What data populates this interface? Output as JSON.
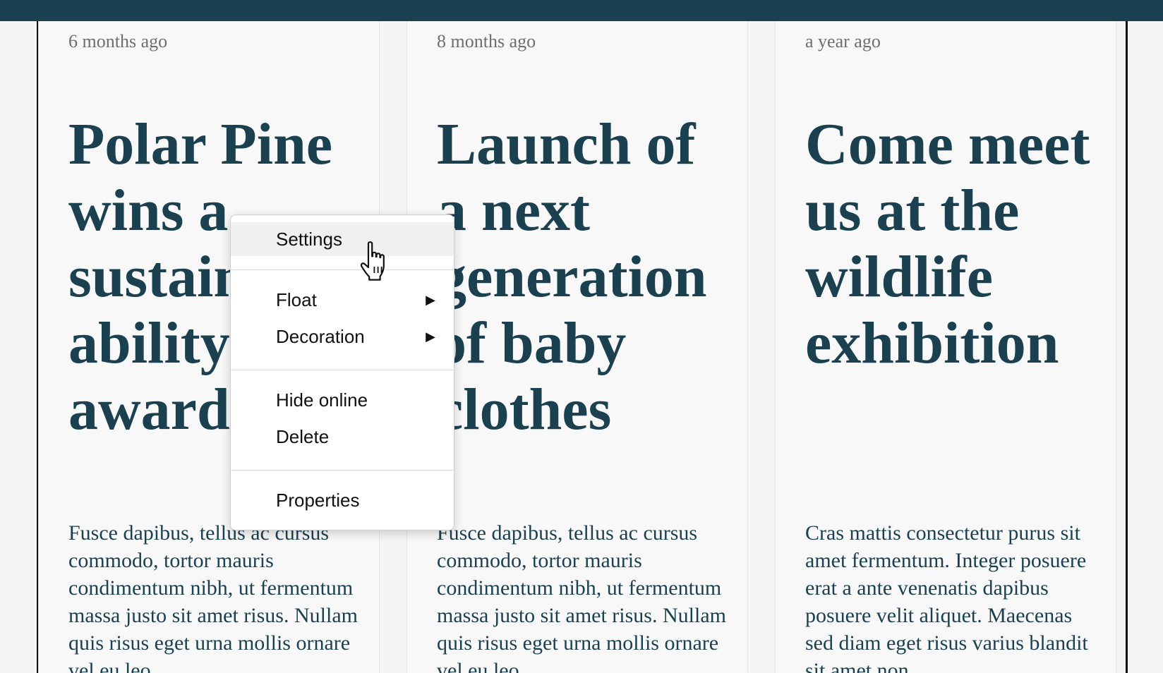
{
  "cards": [
    {
      "date": "6 months ago",
      "title": "Polar Pine wins a sustain-ability award",
      "body": "Fusce dapibus, tellus ac cursus commodo, tortor mauris condimentum nibh, ut fermentum massa justo sit amet risus. Nullam quis risus eget urna mollis ornare vel eu leo."
    },
    {
      "date": "8 months ago",
      "title": "Launch of a next generation of baby clothes",
      "body": "Fusce dapibus, tellus ac cursus commodo, tortor mauris condimentum nibh, ut fermentum massa justo sit amet risus. Nullam quis risus eget urna mollis ornare vel eu leo."
    },
    {
      "date": "a year ago",
      "title": "Come meet us at the wildlife exhibition",
      "body": "Cras mattis consectetur purus sit amet fermentum. Integer posuere erat a ante venenatis dapibus posuere velit aliquet. Maecenas sed diam eget risus varius blandit sit amet non"
    }
  ],
  "context_menu": {
    "settings": "Settings",
    "float": "Float",
    "decoration": "Decoration",
    "submenu_arrow": "▶",
    "hide_online": "Hide online",
    "delete": "Delete",
    "properties": "Properties",
    "highlighted_item": "Settings"
  },
  "cursor": {
    "icon": "hand-pointer-icon"
  },
  "colors": {
    "topbar": "#1b4150",
    "title": "#1b4150",
    "date": "#6e6e6e",
    "menu_highlight": "#f0f0f0"
  }
}
